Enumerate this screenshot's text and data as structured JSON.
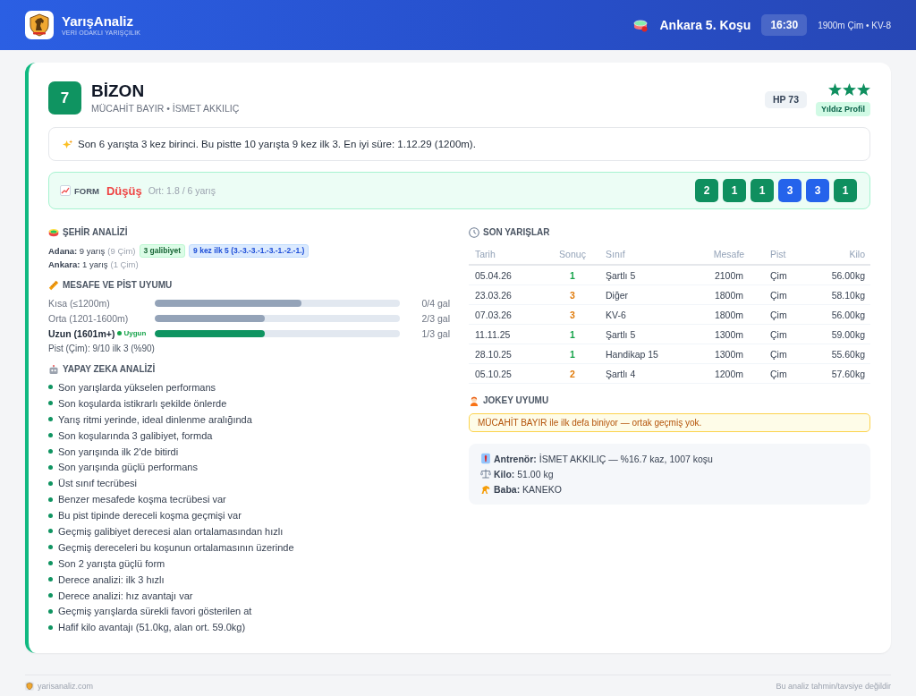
{
  "header": {
    "brand": "YarışAnaliz",
    "tagline": "VERİ ODAKLI YARIŞÇILIK",
    "race": "Ankara 5. Koşu",
    "time": "16:30",
    "details": "1900m Çim • KV-8"
  },
  "horse": {
    "number": "7",
    "name": "BİZON",
    "connections": "MÜCAHİT BAYIR • İSMET AKKILIÇ",
    "hp": "HP 73",
    "stars": 3,
    "profile_tag": "Yıldız Profil",
    "summary": "Son 6 yarışta 3 kez birinci. Bu pistte 10 yarışta 9 kez ilk 3. En iyi süre: 1.12.29 (1200m)."
  },
  "form": {
    "label": "FORM",
    "trend": "Düşüş",
    "average": "Ort: 1.8 / 6 yarış",
    "results": [
      {
        "value": "2",
        "color": "#0f8f5f"
      },
      {
        "value": "1",
        "color": "#0f8f5f"
      },
      {
        "value": "1",
        "color": "#0f8f5f"
      },
      {
        "value": "3",
        "color": "#2563eb"
      },
      {
        "value": "3",
        "color": "#2563eb"
      },
      {
        "value": "1",
        "color": "#0f8f5f"
      }
    ]
  },
  "city_analysis": {
    "title": "ŞEHİR ANALİZİ",
    "cities": [
      {
        "stats": "**Adana:** 9 yarış",
        "surface": "(9 Çim)",
        "tags": [
          {
            "text": "3 galibiyet",
            "kind": "win"
          },
          {
            "text": "9 kez ilk 5 (3.-3.-3.-1.-3.-1.-2.-1.)",
            "kind": "top"
          }
        ]
      },
      {
        "stats": "**Ankara:** 1 yarış",
        "surface": "(1 Çim)"
      }
    ]
  },
  "distance": {
    "title": "MESAFE VE PİST UYUMU",
    "rows": [
      {
        "label": "Kısa (≤1200m)",
        "suitable": false,
        "level": 0.6,
        "value": "0/4 gal"
      },
      {
        "label": "Orta (1201-1600m)",
        "suitable": false,
        "level": 0.45,
        "value": "2/3 gal"
      },
      {
        "label": "Uzun (1601m+)",
        "suitable": true,
        "tag": "Uygun",
        "level": 0.45,
        "value": "1/3 gal"
      }
    ],
    "track_note": "Pist (Çim): 9/10 ilk 3 (%90)"
  },
  "ai_analysis": {
    "title": "YAPAY ZEKA ANALİZİ",
    "items": [
      "Son yarışlarda yükselen performans",
      "Son koşularda istikrarlı şekilde önlerde",
      "Yarış ritmi yerinde, ideal dinlenme aralığında",
      "Son koşularında 3 galibiyet, formda",
      "Son yarışında ilk 2'de bitirdi",
      "Son yarışında güçlü performans",
      "Üst sınıf tecrübesi",
      "Benzer mesafede koşma tecrübesi var",
      "Bu pist tipinde dereceli koşma geçmişi var",
      "Geçmiş galibiyet derecesi alan ortalamasından hızlı",
      "Geçmiş dereceleri bu koşunun ortalamasının üzerinde",
      "Son 2 yarışta güçlü form",
      "Derece analizi: ilk 3 hızlı",
      "Derece analizi: hız avantajı var",
      "Geçmiş yarışlarda sürekli favori gösterilen at",
      "Hafif kilo avantajı (51.0kg, alan ort. 59.0kg)"
    ]
  },
  "recent_races": {
    "title": "SON YARIŞLAR",
    "columns": [
      "Tarih",
      "Sonuç",
      "Sınıf",
      "Mesafe",
      "Pist",
      "Kilo"
    ],
    "rows": [
      {
        "date": "05.04.26",
        "result": "1",
        "color": "#16a34a",
        "class": "Şartlı 5",
        "distance": "2100m",
        "track": "Çim",
        "weight": "56.00kg"
      },
      {
        "date": "23.03.26",
        "result": "3",
        "color": "#e07b0c",
        "class": "Diğer",
        "distance": "1800m",
        "track": "Çim",
        "weight": "58.10kg"
      },
      {
        "date": "07.03.26",
        "result": "3",
        "color": "#e07b0c",
        "class": "KV-6",
        "distance": "1800m",
        "track": "Çim",
        "weight": "56.00kg"
      },
      {
        "date": "11.11.25",
        "result": "1",
        "color": "#16a34a",
        "class": "Şartlı 5",
        "distance": "1300m",
        "track": "Çim",
        "weight": "59.00kg"
      },
      {
        "date": "28.10.25",
        "result": "1",
        "color": "#16a34a",
        "class": "Handikap 15",
        "distance": "1300m",
        "track": "Çim",
        "weight": "55.60kg"
      },
      {
        "date": "05.10.25",
        "result": "2",
        "color": "#e07b0c",
        "class": "Şartlı 4",
        "distance": "1200m",
        "track": "Çim",
        "weight": "57.60kg"
      }
    ]
  },
  "jockey": {
    "title": "JOKEY UYUMU",
    "note": "MÜCAHİT BAYIR ile ilk defa biniyor — ortak geçmiş yok."
  },
  "details": [
    {
      "kind": "trainer",
      "text": "**Antrenör:** İSMET AKKILIÇ — %16.7 kaz, 1007 koşu"
    },
    {
      "kind": "weight",
      "text": "**Kilo:** 51.00 kg"
    },
    {
      "kind": "sire",
      "text": "**Baba:** KANEKO"
    }
  ],
  "footer": {
    "site": "yarisanaliz.com",
    "disclaimer": "Bu analiz tahmin/tavsiye değildir"
  }
}
